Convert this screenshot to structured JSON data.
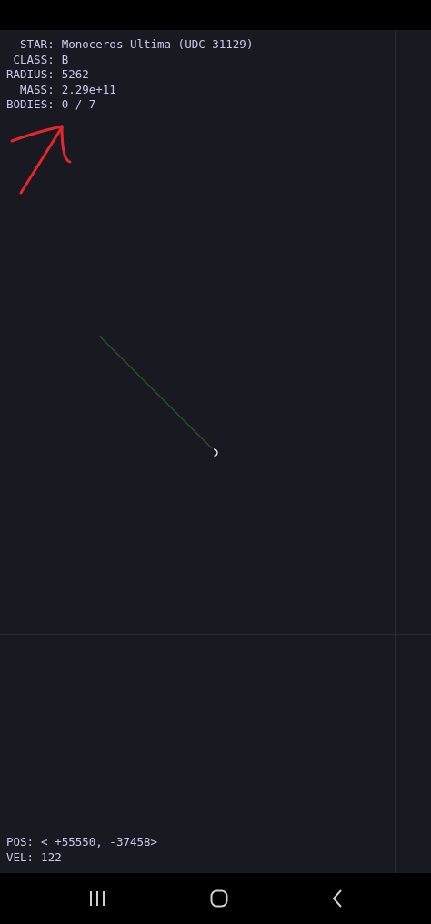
{
  "star_info": [
    {
      "label": "STAR:",
      "value": "Monoceros Ultima (UDC-31129)"
    },
    {
      "label": "CLASS:",
      "value": "B"
    },
    {
      "label": "RADIUS:",
      "value": "5262"
    },
    {
      "label": "MASS:",
      "value": "2.29e+11"
    },
    {
      "label": "BODIES:",
      "value": "0 / 7"
    }
  ],
  "ship_status": [
    {
      "label": "POS:",
      "value": "< +55550, -37458>"
    },
    {
      "label": "VEL:",
      "value": "122"
    }
  ]
}
